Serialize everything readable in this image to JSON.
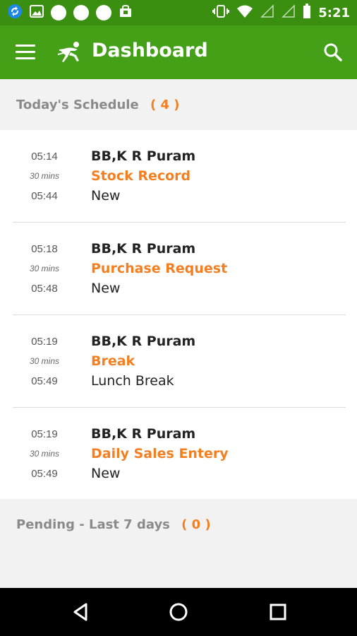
{
  "status_bar": {
    "time": "5:21",
    "icons": [
      "sync-icon",
      "image-icon",
      "notification-dot",
      "notification-dot",
      "notification-dot",
      "store-icon",
      "vibrate-icon",
      "wifi-icon",
      "signal-icon",
      "signal-icon",
      "battery-icon"
    ]
  },
  "app_bar": {
    "title": "Dashboard",
    "menu_icon": "hamburger-menu-icon",
    "logo_icon": "running-man-icon",
    "search_icon": "search-icon",
    "color": "#43a017"
  },
  "schedule": {
    "label": "Today's Schedule",
    "count": "( 4 )",
    "items": [
      {
        "start": "05:14",
        "duration": "30 mins",
        "end": "05:44",
        "location": "BB,K R Puram",
        "title": "Stock Record",
        "status": "New"
      },
      {
        "start": "05:18",
        "duration": "30 mins",
        "end": "05:48",
        "location": "BB,K R Puram",
        "title": "Purchase Request",
        "status": "New"
      },
      {
        "start": "05:19",
        "duration": "30 mins",
        "end": "05:49",
        "location": "BB,K R Puram",
        "title": "Break",
        "status": "Lunch Break"
      },
      {
        "start": "05:19",
        "duration": "30 mins",
        "end": "05:49",
        "location": "BB,K R Puram",
        "title": "Daily Sales Entery",
        "status": "New"
      }
    ]
  },
  "pending": {
    "label": "Pending - Last 7 days",
    "count": "( 0 )"
  },
  "nav_bar": {
    "icons": [
      "back-icon",
      "home-icon",
      "recents-icon"
    ]
  },
  "colors": {
    "accent": "#f47f20",
    "status_bar": "#3b8f10"
  }
}
